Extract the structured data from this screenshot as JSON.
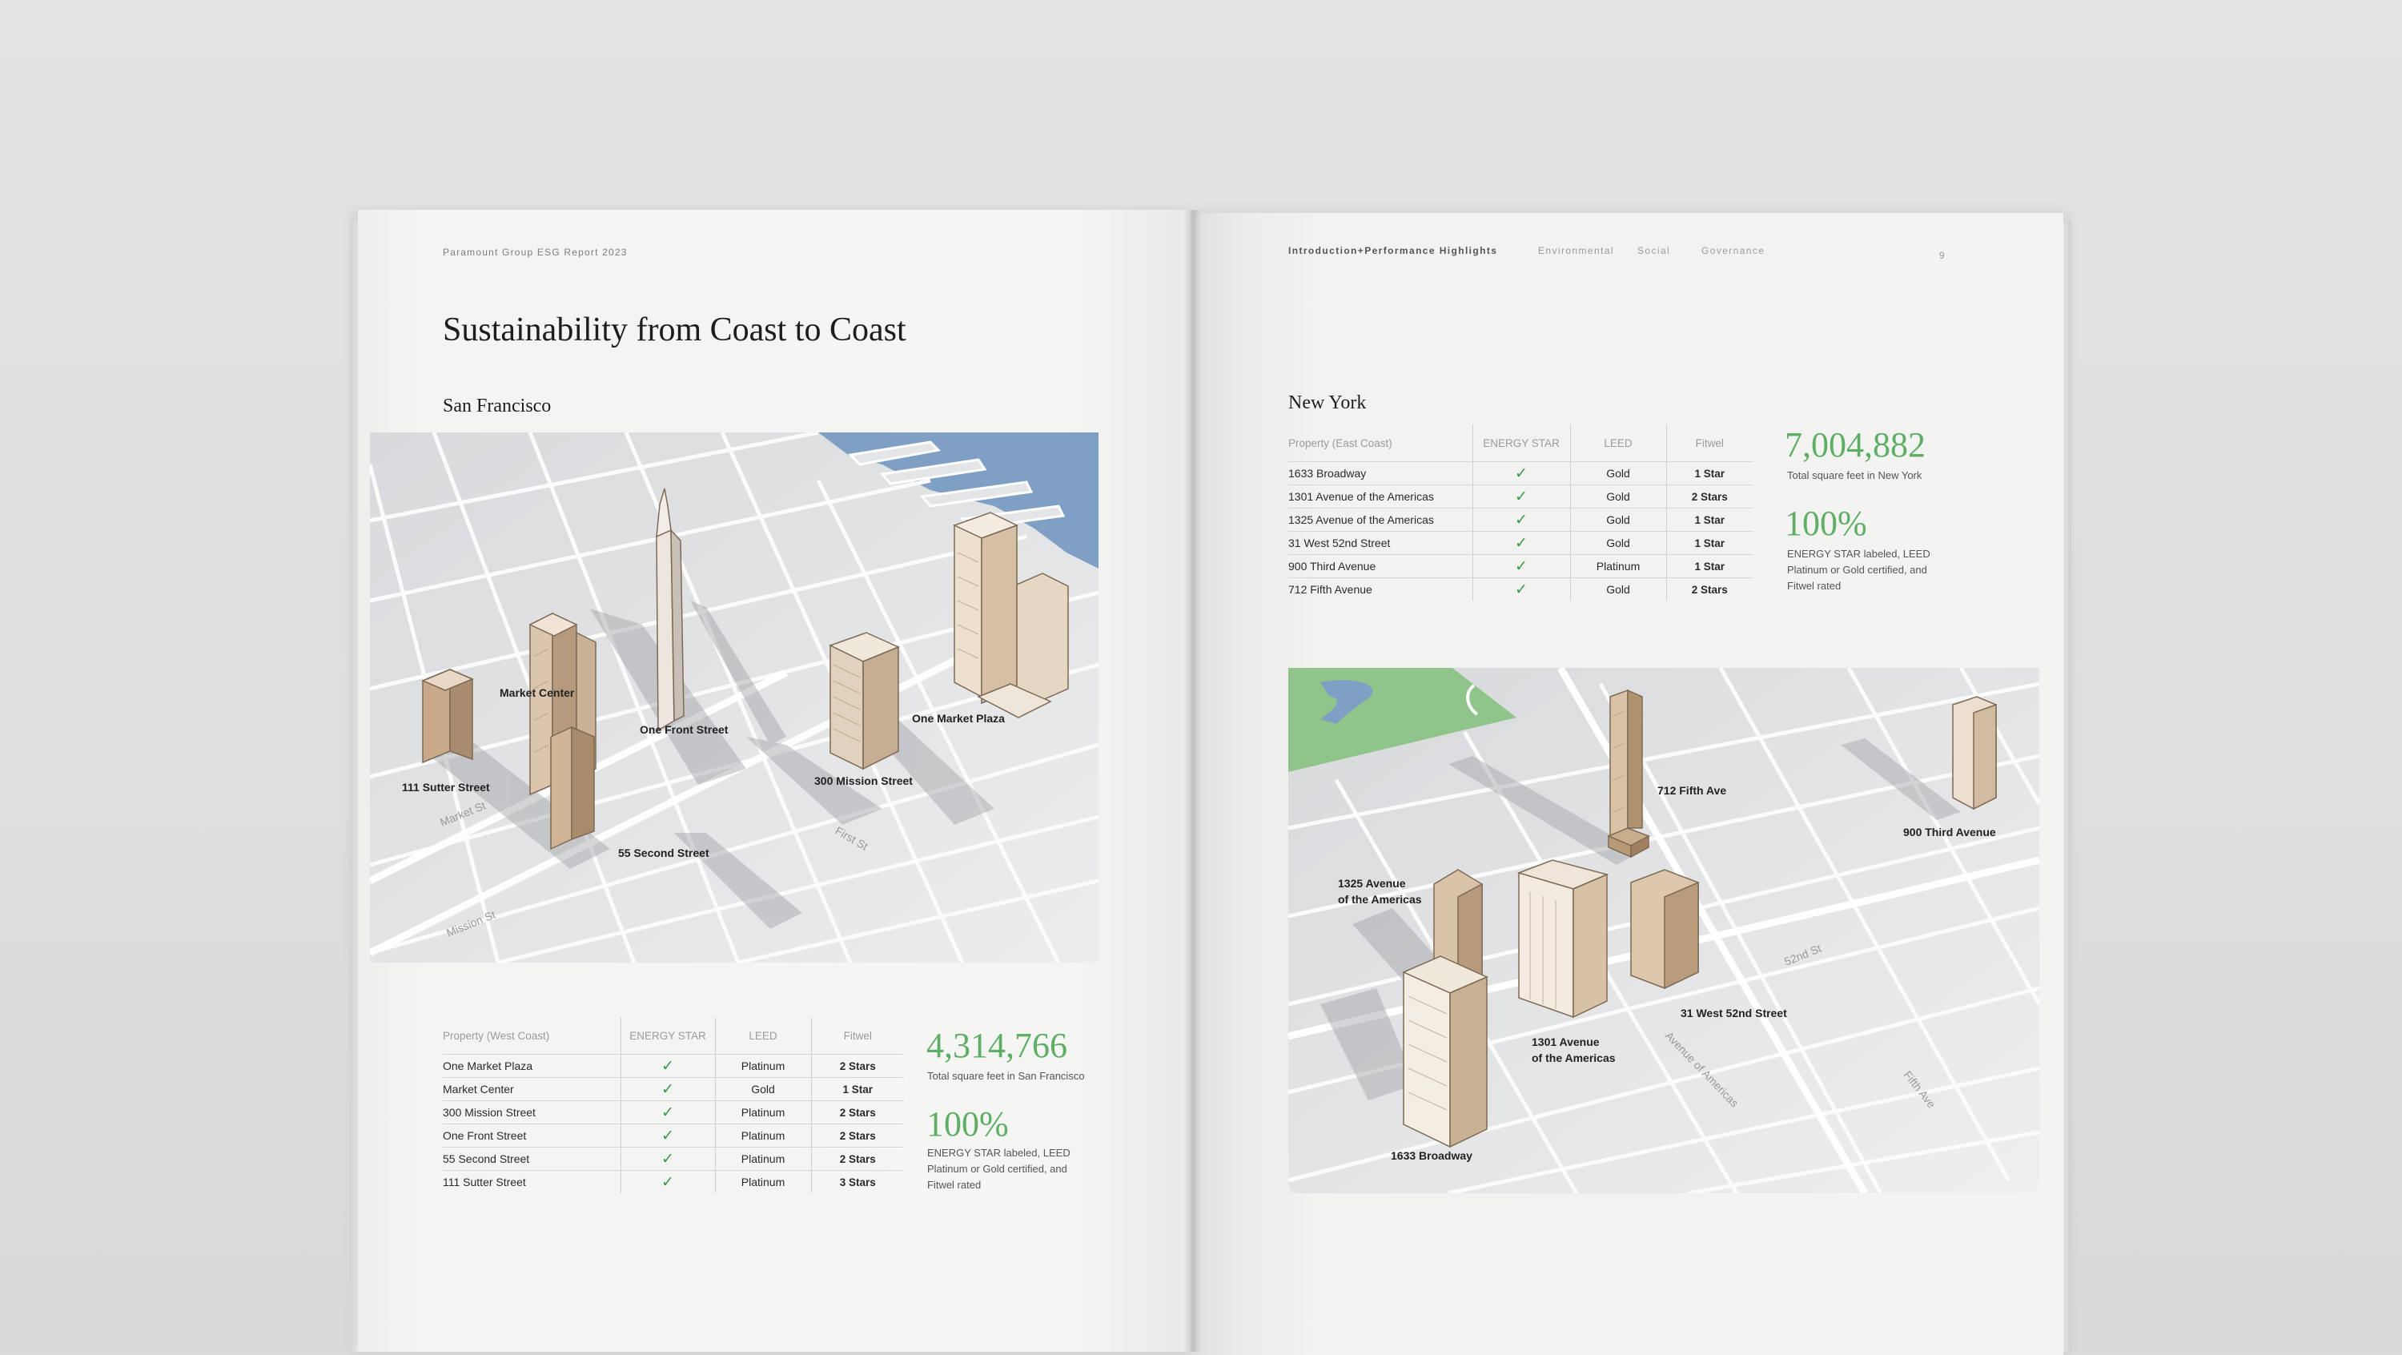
{
  "left_page": {
    "running_head": "Paramount Group ESG Report 2023",
    "title": "Sustainability from Coast to Coast",
    "section": "San Francisco",
    "map": {
      "labels": [
        "Market Center",
        "111 Sutter Street",
        "One Front Street",
        "300 Mission Street",
        "One Market Plaza",
        "55 Second Street"
      ],
      "streets": [
        "Market St",
        "First St",
        "Mission St"
      ]
    },
    "table": {
      "headers": [
        "Property (West Coast)",
        "ENERGY STAR",
        "LEED",
        "Fitwel"
      ],
      "rows": [
        {
          "property": "One Market Plaza",
          "energy_star": "✓",
          "leed": "Platinum",
          "fitwel": "2 Stars"
        },
        {
          "property": "Market Center",
          "energy_star": "✓",
          "leed": "Gold",
          "fitwel": "1 Star"
        },
        {
          "property": "300 Mission Street",
          "energy_star": "✓",
          "leed": "Platinum",
          "fitwel": "2 Stars"
        },
        {
          "property": "One Front Street",
          "energy_star": "✓",
          "leed": "Platinum",
          "fitwel": "2 Stars"
        },
        {
          "property": "55 Second Street",
          "energy_star": "✓",
          "leed": "Platinum",
          "fitwel": "2 Stars"
        },
        {
          "property": "111 Sutter Street",
          "energy_star": "✓",
          "leed": "Platinum",
          "fitwel": "3 Stars"
        }
      ]
    },
    "stats": [
      {
        "value": "4,314,766",
        "caption": "Total square feet in San Francisco"
      },
      {
        "value": "100%",
        "caption_lines": [
          "ENERGY STAR labeled, LEED",
          "Platinum or Gold certified, and",
          "Fitwel rated"
        ]
      }
    ]
  },
  "right_page": {
    "nav": [
      "Introduction+Performance Highlights",
      "Environmental",
      "Social",
      "Governance"
    ],
    "page_number": "9",
    "section": "New York",
    "table": {
      "headers": [
        "Property (East Coast)",
        "ENERGY STAR",
        "LEED",
        "Fitwel"
      ],
      "rows": [
        {
          "property": "1633 Broadway",
          "energy_star": "✓",
          "leed": "Gold",
          "fitwel": "1 Star"
        },
        {
          "property": "1301 Avenue of the Americas",
          "energy_star": "✓",
          "leed": "Gold",
          "fitwel": "2 Stars"
        },
        {
          "property": "1325 Avenue of the Americas",
          "energy_star": "✓",
          "leed": "Gold",
          "fitwel": "1 Star"
        },
        {
          "property": "31 West 52nd Street",
          "energy_star": "✓",
          "leed": "Gold",
          "fitwel": "1 Star"
        },
        {
          "property": "900 Third Avenue",
          "energy_star": "✓",
          "leed": "Platinum",
          "fitwel": "1 Star"
        },
        {
          "property": "712 Fifth Avenue",
          "energy_star": "✓",
          "leed": "Gold",
          "fitwel": "2 Stars"
        }
      ]
    },
    "stats": [
      {
        "value": "7,004,882",
        "caption": "Total square feet in New York"
      },
      {
        "value": "100%",
        "caption_lines": [
          "ENERGY STAR labeled, LEED",
          "Platinum or Gold certified, and",
          "Fitwel rated"
        ]
      }
    ],
    "map": {
      "labels": [
        "712 Fifth Ave",
        "900 Third Avenue",
        "1325 Avenue",
        "of the Americas",
        "31 West 52nd Street",
        "1301 Avenue",
        "of the Americas",
        "1633 Broadway"
      ],
      "streets": [
        "52nd St",
        "Avenue of Americas",
        "Fifth Ave"
      ]
    }
  },
  "colors": {
    "accent_green": "#5eae66",
    "check_green": "#3a9a47",
    "building": "#d9c2a6",
    "water": "#7f9fc4",
    "park": "#8fc48a"
  }
}
